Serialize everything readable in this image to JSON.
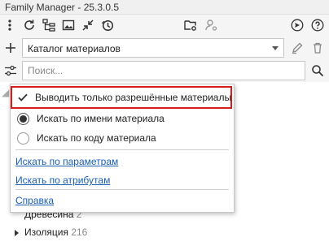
{
  "window": {
    "title": "Family Manager - 25.3.0.5"
  },
  "toolbar": {
    "left_icons": [
      "more-vertical-icon",
      "refresh-icon",
      "tree-structure-icon",
      "image-icon",
      "collapse-icon",
      "history-icon"
    ],
    "mid_icons": [
      "folder-settings-icon",
      "user-settings-icon"
    ],
    "right_icons": [
      "send-icon",
      "help-icon"
    ]
  },
  "catalog": {
    "selected": "Каталог материалов"
  },
  "search": {
    "placeholder": "Поиск..."
  },
  "tree": {
    "items": [
      {
        "label": "Древесина",
        "count": "2"
      },
      {
        "label": "Изоляция",
        "count": "216"
      }
    ]
  },
  "popup": {
    "checkbox_label": "Выводить только разрешённые материалы",
    "checkbox_checked": true,
    "radio_name_label": "Искать по имени материала",
    "radio_code_label": "Искать по коду материала",
    "radio_selected": "name",
    "link_params": "Искать по параметрам",
    "link_attrs": "Искать по атрибутам",
    "link_help": "Справка"
  },
  "colors": {
    "highlight": "#d81b1b",
    "link": "#1a5fb4",
    "accent": "#2b7bd6"
  }
}
